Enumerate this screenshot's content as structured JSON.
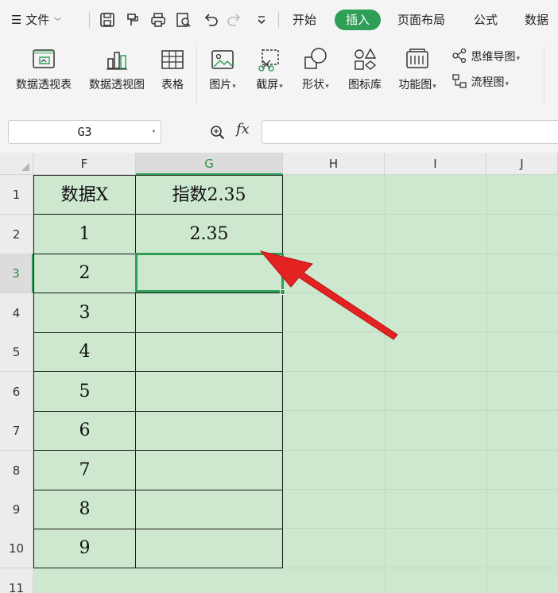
{
  "menubar": {
    "file_label": "文件",
    "tabs": [
      "开始",
      "插入",
      "页面布局",
      "公式",
      "数据"
    ],
    "active_tab": "插入"
  },
  "ribbon": {
    "buttons": [
      "数据透视表",
      "数据透视图",
      "表格",
      "图片",
      "截屏",
      "形状",
      "图标库",
      "功能图"
    ],
    "small": [
      "思维导图",
      "流程图"
    ]
  },
  "formula_bar": {
    "name_box": "G3",
    "fx_label": "fx",
    "formula": ""
  },
  "sheet": {
    "columns": [
      "F",
      "G",
      "H",
      "I",
      "J"
    ],
    "active_column": "G",
    "rows": [
      "1",
      "2",
      "3",
      "4",
      "5",
      "6",
      "7",
      "8",
      "9",
      "10",
      "11"
    ],
    "active_row": "3",
    "header_x": "数据X",
    "header_g": "指数2.35",
    "f_values": [
      "1",
      "2",
      "3",
      "4",
      "5",
      "6",
      "7",
      "8",
      "9"
    ],
    "g_value_row2": "2.35"
  },
  "annotation": {
    "arrow_color": "#e32222",
    "points_to": "G2"
  },
  "colors": {
    "accent": "#2f9e57",
    "grid_bg": "#cde8cf"
  }
}
